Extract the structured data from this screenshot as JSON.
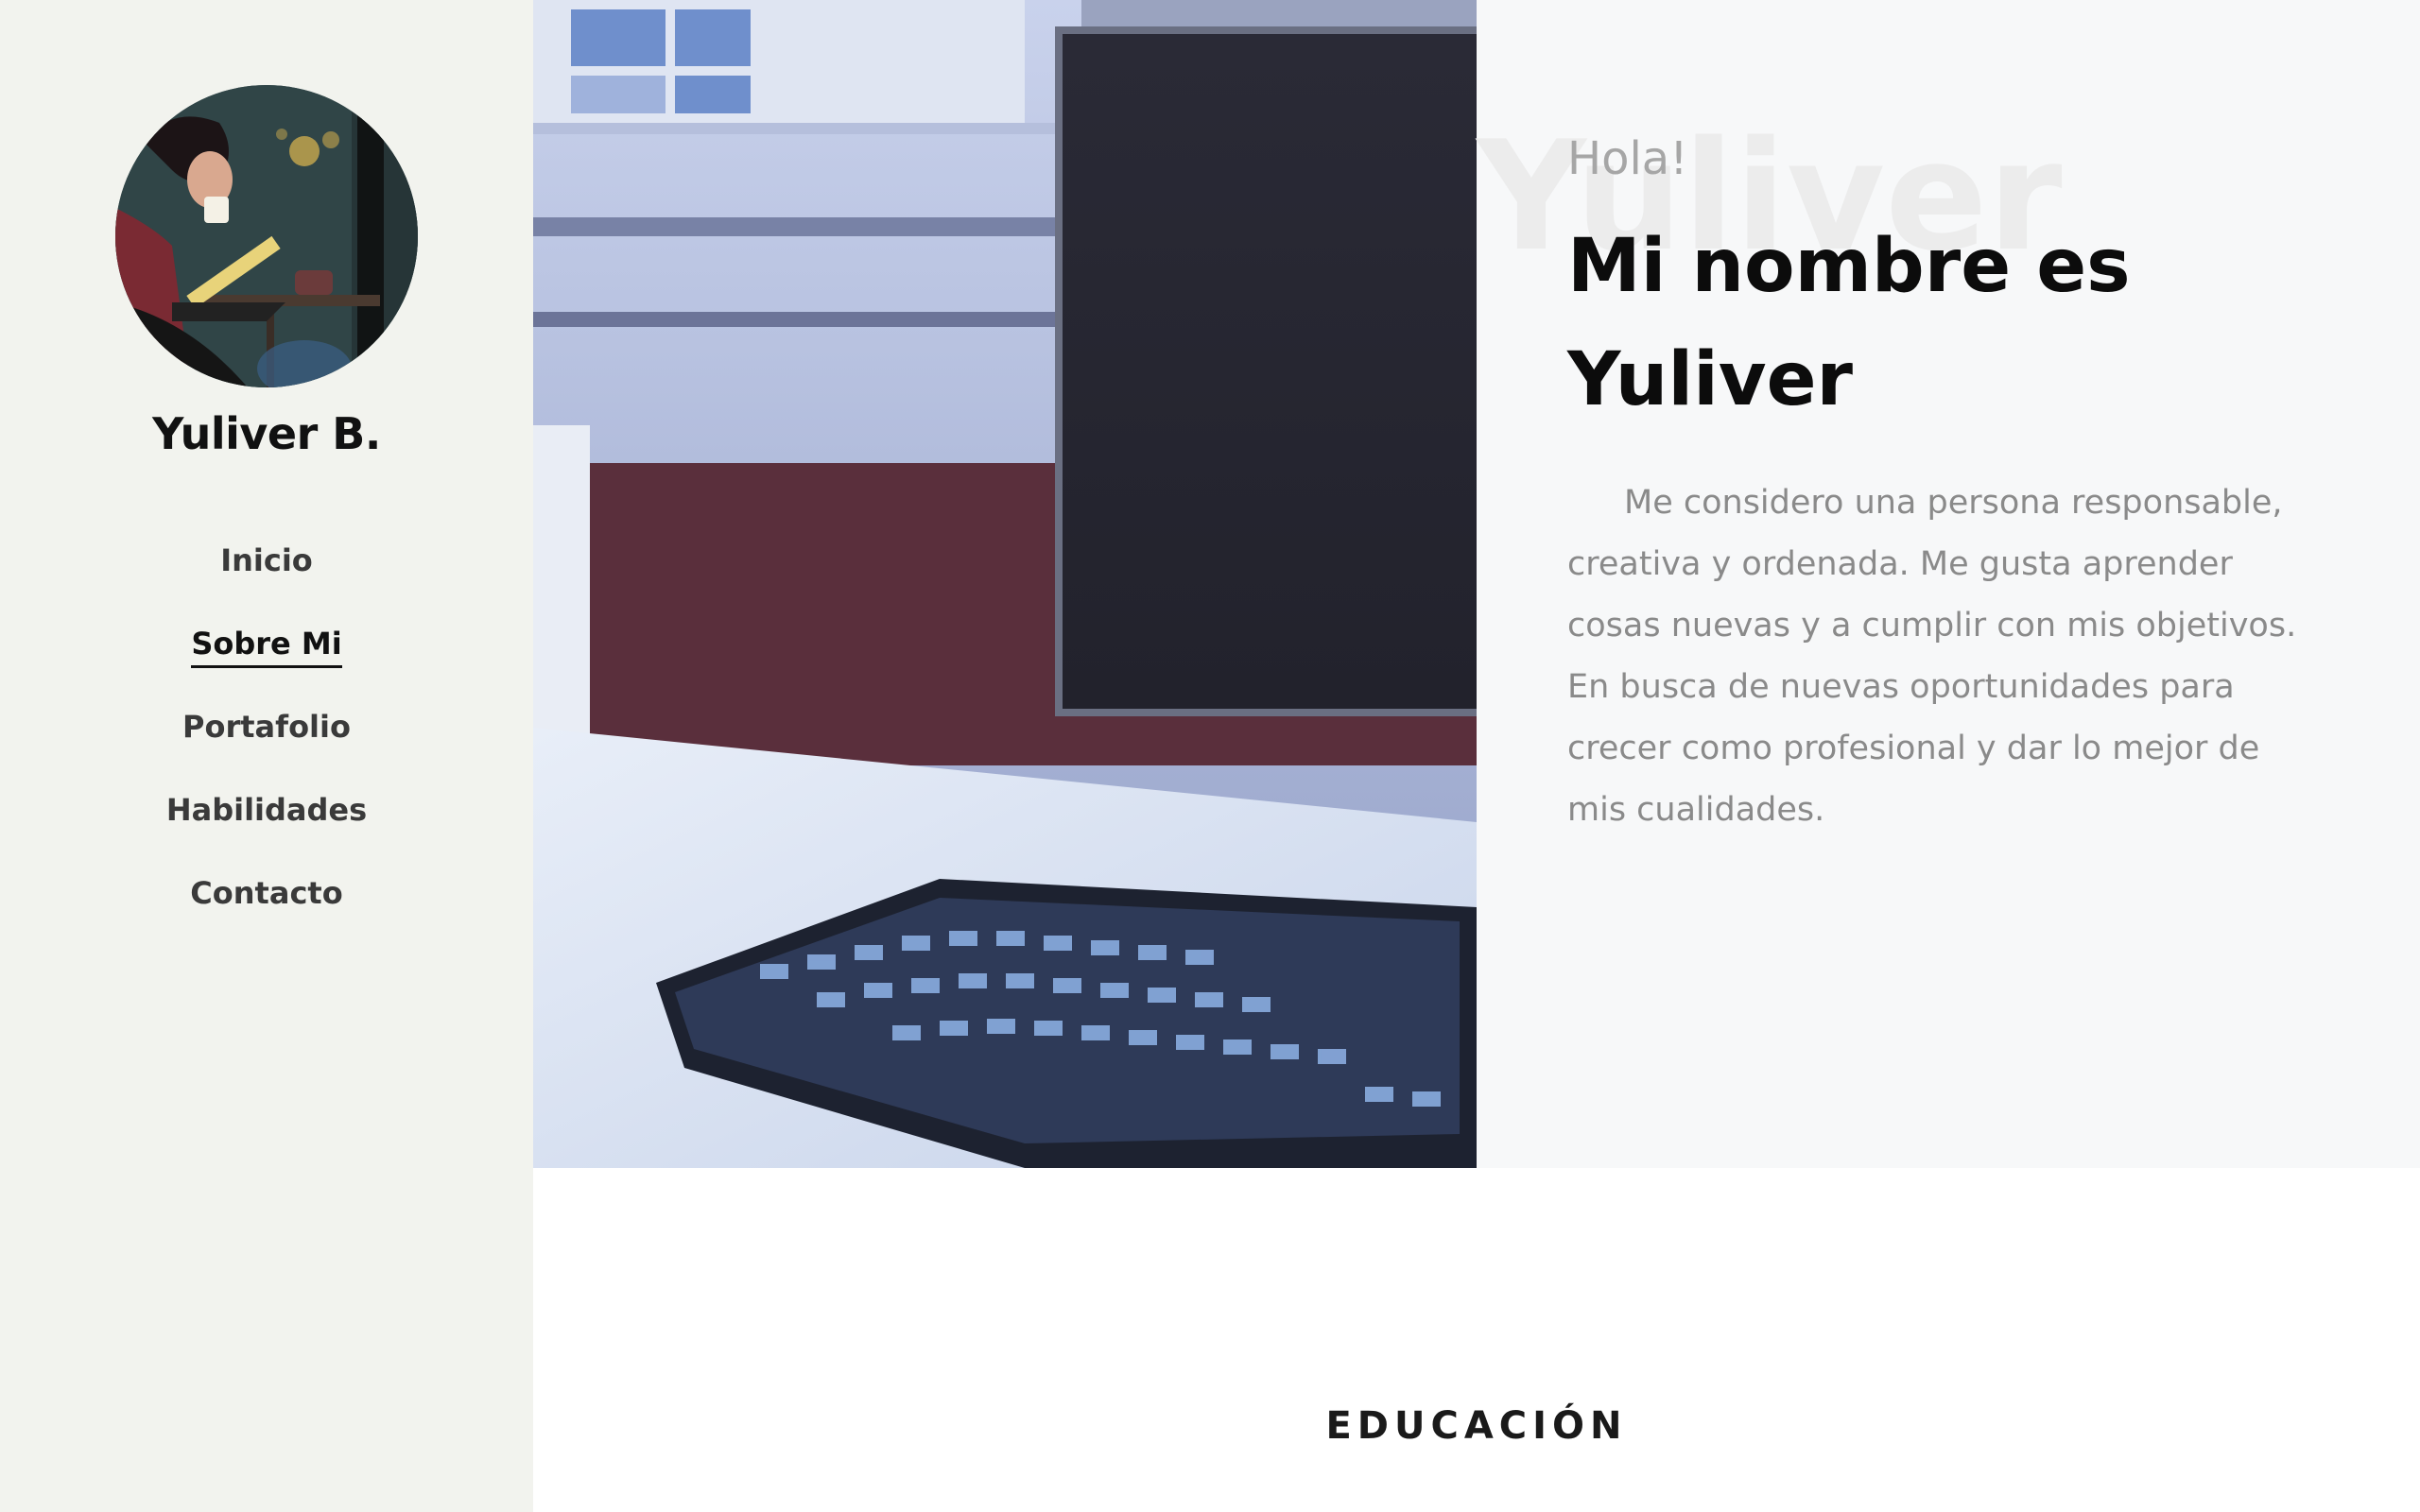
{
  "sidebar": {
    "brand": "Yuliver B.",
    "nav": [
      {
        "label": "Inicio",
        "active": false
      },
      {
        "label": "Sobre Mi",
        "active": true
      },
      {
        "label": "Portafolio",
        "active": false
      },
      {
        "label": "Habilidades",
        "active": false
      },
      {
        "label": "Contacto",
        "active": false
      }
    ]
  },
  "intro": {
    "watermark": "Yuliver",
    "greeting": "Hola!",
    "headline": "Mi nombre es Yuliver",
    "bio": "Me considero una persona responsable, creativa y ordenada. Me gusta aprender cosas nuevas y a cumplir con mis objetivos. En busca de nuevas oportunidades para crecer como profesional y dar lo mejor de mis cualidades."
  },
  "education": {
    "title": "EDUCACIÓN"
  },
  "colors": {
    "sidebar_bg": "#f2f3ee",
    "intro_bg": "#f7f8f9",
    "heading": "#0c0c0c",
    "body_text": "#8a8a8a"
  }
}
